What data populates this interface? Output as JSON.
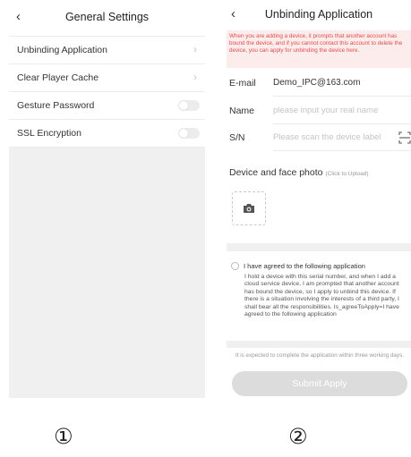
{
  "screen1": {
    "back_icon": "‹",
    "title": "General Settings",
    "items": [
      {
        "label": "Unbinding Application",
        "control": "chevron"
      },
      {
        "label": "Clear Player Cache",
        "control": "chevron"
      },
      {
        "label": "Gesture Password",
        "control": "toggle",
        "on": false
      },
      {
        "label": "SSL Encryption",
        "control": "toggle",
        "on": false
      }
    ],
    "chevron": "›"
  },
  "screen2": {
    "back_icon": "‹",
    "title": "Unbinding Application",
    "warning": "When you are adding a device, it prompts that another account has bound the device, and if you cannot contact this account to delete the device, you can apply for unbinding the device here.",
    "email_label": "E-mail",
    "email_value": "Demo_IPC@163.com",
    "name_label": "Name",
    "name_placeholder": "please input your real name",
    "sn_label": "S/N",
    "sn_placeholder": "Please scan the device label",
    "photo_title": "Device and face photo",
    "photo_hint": "(Click to Upload)",
    "agree_title": "I have agreed to the following application",
    "agree_body": "I hold a device with this serial number, and when I add a cloud service device, I am prompted that another account has bound the device, so I apply to unbind this device. If there is a situation involving the interests of a third party, I shall bear all the responsibilities. Is_agreeToApply=I have agreed to the following application",
    "expect_note": "It is expected to complete the application within three working days.",
    "submit_label": "Submit Apply"
  },
  "markers": [
    "①",
    "②"
  ],
  "colors": {
    "warning_bg": "#fdecec",
    "warning_text": "#e04b4b",
    "button_disabled": "#dcdcdc",
    "page_bg": "#f0f0f0"
  },
  "icons": {
    "scan": "scan-icon",
    "camera": "camera-icon",
    "chevron": "chevron-right-icon",
    "back": "back-icon"
  }
}
